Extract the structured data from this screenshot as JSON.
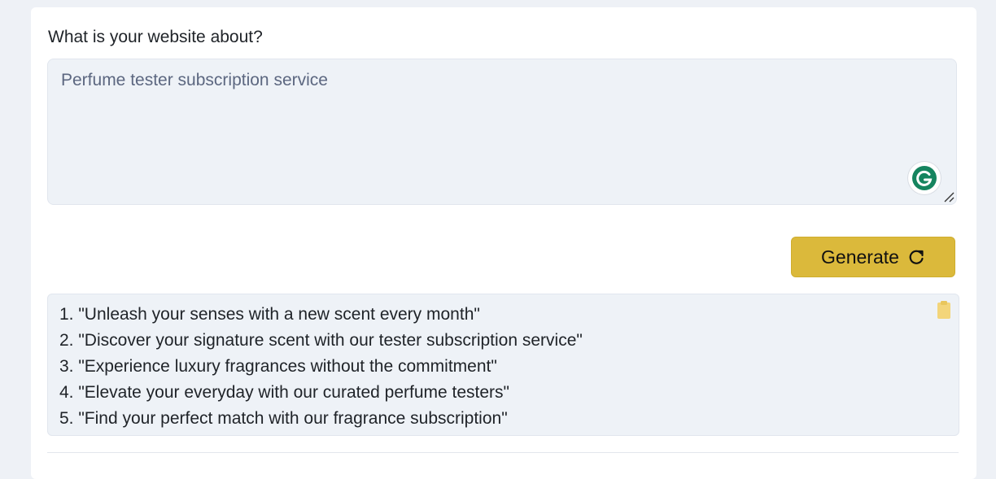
{
  "form": {
    "question_label": "What is your website about?",
    "textarea_value": "Perfume tester subscription service"
  },
  "generate_button": {
    "label": "Generate",
    "icon": "refresh-icon",
    "color": "#dbb93b"
  },
  "results": {
    "items": [
      "1. \"Unleash your senses with a new scent every month\"",
      "2. \"Discover your signature scent with our tester subscription service\"",
      "3. \"Experience luxury fragrances without the commitment\"",
      "4. \"Elevate your everyday with our curated perfume testers\"",
      "5. \"Find your perfect match with our fragrance subscription\""
    ],
    "copy_icon": "clipboard-icon"
  },
  "colors": {
    "page_background": "#eef1f6",
    "field_background": "#eef2f7",
    "grammarly_green": "#15845f"
  }
}
